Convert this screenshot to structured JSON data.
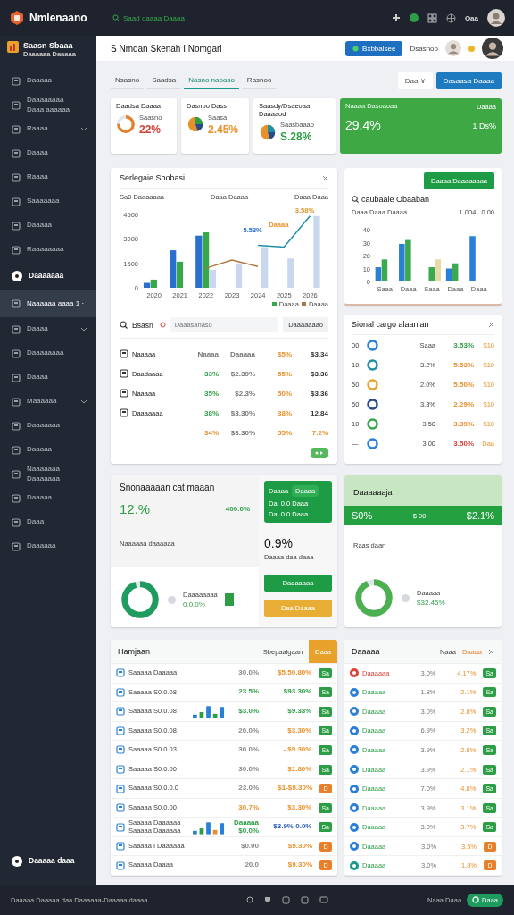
{
  "topbar": {
    "brand": "Nmlenaano",
    "search": "Saad daaaa Daaaa",
    "user_label": "Oaa"
  },
  "sidebar": {
    "workspace": "Saasn Sbaaa",
    "workspace_sub": "Daaaaaa Daaaaa",
    "items": [
      {
        "label": "Daaaaa",
        "kind": "link",
        "selected": false,
        "expandable": false
      },
      {
        "label": "Daaaaaaaa",
        "sublabel": "Daaa aaaaaa",
        "kind": "link",
        "selected": false,
        "expandable": false
      },
      {
        "label": "Raaaa",
        "kind": "link",
        "selected": false,
        "expandable": true
      },
      {
        "label": "Daaaa",
        "kind": "link",
        "selected": false,
        "expandable": false
      },
      {
        "label": "Raaaa",
        "kind": "link",
        "selected": false,
        "expandable": false
      },
      {
        "label": "Saaaaaaa",
        "kind": "link",
        "selected": false,
        "expandable": false
      },
      {
        "label": "Daaaaa",
        "kind": "link",
        "selected": false,
        "expandable": false
      },
      {
        "label": "Raaaaaaaa",
        "kind": "link",
        "selected": false,
        "expandable": false
      },
      {
        "label": "Daaaaaaa",
        "kind": "heading",
        "selected": false,
        "expandable": false
      },
      {
        "label": "Naaaaaa aaaa 1 ·",
        "kind": "link",
        "selected": true,
        "expandable": false
      },
      {
        "label": "Daaaa",
        "kind": "link",
        "selected": false,
        "expandable": true
      },
      {
        "label": "Daaaaaaaa",
        "kind": "link",
        "selected": false,
        "expandable": false
      },
      {
        "label": "Daaaa",
        "kind": "link",
        "selected": false,
        "expandable": false
      },
      {
        "label": "Maaaaaa",
        "kind": "link",
        "selected": false,
        "expandable": true
      },
      {
        "label": "Daaaaaaa",
        "kind": "link",
        "selected": false,
        "expandable": false
      },
      {
        "label": "Daaaaa",
        "kind": "link",
        "selected": false,
        "expandable": false
      },
      {
        "label": "Naaaaaaa",
        "sublabel": "Daaaaaaa",
        "kind": "link",
        "selected": false,
        "expandable": false
      },
      {
        "label": "Daaaaa",
        "kind": "link",
        "selected": false,
        "expandable": false
      },
      {
        "label": "Daaa",
        "kind": "link",
        "selected": false,
        "expandable": false
      },
      {
        "label": "Daaaaaa",
        "kind": "link",
        "selected": false,
        "expandable": false
      }
    ],
    "footer_item": {
      "label": "Daaaaa daaa",
      "kind": "heading"
    }
  },
  "header": {
    "title": "S Nmdan Skenah I Nomgari",
    "action_button": "Bxbbalsee",
    "user_name": "Dsasnoo"
  },
  "tabs": [
    {
      "label": "Nsasno",
      "selected": false
    },
    {
      "label": "Saadsa",
      "selected": false
    },
    {
      "label": "Nasno naoaso",
      "selected": true
    },
    {
      "label": "Rasnoo",
      "selected": false
    }
  ],
  "toolbar_buttons": [
    {
      "label": "Daa ∨",
      "kind": "secondary"
    },
    {
      "label": "Dasaasa Daaaa",
      "kind": "primary"
    }
  ],
  "kpis": [
    {
      "kind": "donut",
      "title": "Daadsa Daaaa",
      "label": "Saasno",
      "value": "22%",
      "color": "#d2453a"
    },
    {
      "kind": "icon",
      "title": "Dasnoo Dass",
      "label": "Saasa",
      "value": "2.45%",
      "color": "#e8912b"
    },
    {
      "kind": "icon",
      "title": "Saasdy/Dsaeoaa Daaaaod",
      "label": "Saasbaaao",
      "value": "S.28%",
      "color": "#2e9e46"
    },
    {
      "kind": "highlight",
      "title": "Naaaa Dasoaoaa",
      "side_label": "Daaaa",
      "value": "29.4%",
      "side_value": "1 Ds%"
    }
  ],
  "sales_card": {
    "title": "Serlegaie Sbobasi",
    "subtitle": "Sa0 Daaaaaaa",
    "filter_1": "Daaa Daaaa",
    "filter_2": "Daaa Daaa",
    "chart_data": {
      "type": "bar",
      "categories": [
        "2020",
        "2021",
        "2022",
        "2023",
        "2024",
        "2025",
        "2026"
      ],
      "ylim": [
        0,
        4500
      ],
      "yticks": [
        0,
        1500,
        3000,
        4500
      ],
      "series": [
        {
          "color": "#2a6fd0",
          "values": [
            300,
            2300,
            3200,
            null,
            null,
            null,
            null
          ]
        },
        {
          "color": "#36a84a",
          "values": [
            500,
            1600,
            3400,
            null,
            null,
            null,
            null
          ]
        },
        {
          "color": "#c9d8ef",
          "values": [
            null,
            null,
            1100,
            1500,
            2500,
            1800,
            4400
          ]
        },
        {
          "color": "#b07840",
          "type": "line",
          "values": [
            null,
            null,
            1200,
            1700,
            1300,
            null,
            null
          ]
        },
        {
          "color": "#1f8fa6",
          "type": "line",
          "values": [
            null,
            null,
            null,
            null,
            2600,
            2500,
            4400
          ]
        }
      ],
      "annotations": [
        "5.53%",
        "Daaaa",
        "3.58%"
      ]
    },
    "legend": [
      {
        "label": "Daaaa",
        "color": "#36a84a"
      },
      {
        "label": "Daaaa",
        "color": "#b07840"
      }
    ],
    "search_label": "Bsasn",
    "search_placeholder": "Daaasanaso",
    "dropdown": "Daaaaaaao",
    "rows": [
      {
        "name": "Naaaaa",
        "cells": [
          {
            "text": "Naaaa",
            "color": "#777777"
          },
          {
            "text": "Daaaaa",
            "color": "#777777"
          },
          {
            "text": "$5%",
            "color": "#e8912b"
          },
          {
            "text": "$3.34",
            "color": "#333333"
          }
        ]
      },
      {
        "name": "Daadaaaa",
        "cells": [
          {
            "text": "33%",
            "color": "#2e9e46"
          },
          {
            "text": "$2.39%",
            "color": "#777777"
          },
          {
            "text": "55%",
            "color": "#e8912b"
          },
          {
            "text": "$3.36",
            "color": "#333333"
          }
        ]
      },
      {
        "name": "Naaaaa",
        "cells": [
          {
            "text": "35%",
            "color": "#2e9e46"
          },
          {
            "text": "$2.3%",
            "color": "#777777"
          },
          {
            "text": "50%",
            "color": "#e8912b"
          },
          {
            "text": "$3.36",
            "color": "#333333"
          }
        ]
      },
      {
        "name": "Daaaaaaa",
        "cells": [
          {
            "text": "38%",
            "color": "#2e9e46"
          },
          {
            "text": "$3.30%",
            "color": "#777777"
          },
          {
            "text": "38%",
            "color": "#e8912b"
          },
          {
            "text": "12.84",
            "color": "#333333"
          }
        ]
      },
      {
        "name": "",
        "cells": [
          {
            "text": "34%",
            "color": "#e8912b"
          },
          {
            "text": "$3.30%",
            "color": "#777777"
          },
          {
            "text": "55%",
            "color": "#e8912b"
          },
          {
            "text": "7.2%",
            "color": "#e8912b"
          }
        ]
      }
    ]
  },
  "cost_card": {
    "button": "Daaaa Daaaaaaaa",
    "title": "caubaaie Obaaban",
    "subtitle": "Daaa Daaa Daaaa",
    "stat_1": "1.004",
    "stat_2": "0.00",
    "chart_data": {
      "type": "bar",
      "categories": [
        "Saaa",
        "Daaa",
        "Saaa",
        "Daaa",
        "Daaa"
      ],
      "ylim": [
        0,
        40
      ],
      "yticks": [
        0,
        10,
        20,
        30,
        40
      ],
      "series": [
        {
          "color": "#2a7fd8",
          "values": [
            11,
            29,
            null,
            10,
            35
          ]
        },
        {
          "color": "#3ba94f",
          "values": [
            17,
            32,
            11,
            14,
            null
          ]
        },
        {
          "color": "#e8d9a8",
          "values": [
            null,
            null,
            17,
            null,
            null
          ]
        }
      ]
    }
  },
  "signal_card": {
    "title": "Sional cargo alaanlan",
    "rows": [
      {
        "index": "00",
        "color": "#2a7fd8",
        "name": "Saaa",
        "value": {
          "text": "3.53%",
          "color": "#2e9e46"
        },
        "extra": "$10"
      },
      {
        "index": "10",
        "color": "#1f8fa6",
        "name": "3.2%",
        "value": {
          "text": "5.53%",
          "color": "#e8912b"
        },
        "extra": "$10"
      },
      {
        "index": "50",
        "color": "#e8a22b",
        "name": "2.0%",
        "value": {
          "text": "5.50%",
          "color": "#e8912b"
        },
        "extra": "$10"
      },
      {
        "index": "50",
        "color": "#274b8a",
        "name": "3.3%",
        "value": {
          "text": "2.29%",
          "color": "#e8912b"
        },
        "extra": "$10"
      },
      {
        "index": "10",
        "color": "#36a84a",
        "name": "3.50",
        "value": {
          "text": "3.39%",
          "color": "#e8912b"
        },
        "extra": "$10"
      },
      {
        "index": "—",
        "color": "#2a7fd8",
        "name": "3.00",
        "value": {
          "text": "3.50%",
          "color": "#d2453a"
        },
        "extra": "Daa"
      }
    ]
  },
  "summary_card": {
    "title": "Snonaaaaan cat maaan",
    "value": "12.%",
    "side_value": "400.0%",
    "label": "Naaaaaa daaaaaa",
    "legend_label": "Daaaaaaaa",
    "legend_value": "0.0.0%",
    "panel": {
      "title": "Daaaa",
      "field": "Daaaa",
      "lines": [
        "Da  0.0 Daaa",
        "Da  0.0 Daaa"
      ]
    },
    "big_value": "0.9%",
    "big_sub": "Daaaa daa daaa",
    "buttons": [
      {
        "label": "Daaaaaaa",
        "kind": "green"
      },
      {
        "label": "Daa Daaaa",
        "kind": "yellow"
      }
    ]
  },
  "growth_card": {
    "title": "Daaaaaaja",
    "band": [
      "S0%",
      "$ 00",
      "$2.1%"
    ],
    "label": "Raas daan",
    "legend_label": "Daaaaa",
    "legend_value": "$32.45%"
  },
  "orders_card": {
    "title": "Hamjaan",
    "link": "Sbepaalgaan",
    "button": "Daaa",
    "rows": [
      {
        "name": "Saaaaa Daaaaa",
        "kind": "plain",
        "pct": {
          "text": "30.0%",
          "color": "#888888"
        },
        "amount": {
          "text": "$5.50.80%",
          "color": "#e8912b"
        },
        "badge": {
          "text": "Sa",
          "color": "#2e9e46"
        }
      },
      {
        "name": "Saaaaa S0.0.08",
        "kind": "plain",
        "pct": {
          "text": "23.5%",
          "color": "#2e9e46"
        },
        "amount": {
          "text": "$93.30%",
          "color": "#2e9e46"
        },
        "badge": {
          "text": "Sa",
          "color": "#2e9e46"
        }
      },
      {
        "name": "Saaaaa S0.0.08",
        "kind": "chart",
        "pct": {
          "text": "$3.0%",
          "color": "#2e9e46"
        },
        "amount": {
          "text": "$9.33%",
          "color": "#2e9e46"
        },
        "badge": {
          "text": "Sa",
          "color": "#2e9e46"
        }
      },
      {
        "name": "Saaaaa S0.0.08",
        "kind": "plain",
        "pct": {
          "text": "20.0%",
          "color": "#888888"
        },
        "amount": {
          "text": "$3.30%",
          "color": "#e8912b"
        },
        "badge": {
          "text": "Sa",
          "color": "#2e9e46"
        }
      },
      {
        "name": "Saaaaa S0.0.03",
        "kind": "plain",
        "pct": {
          "text": "30.0%",
          "color": "#888888"
        },
        "amount": {
          "text": "- $9.30%",
          "color": "#e8912b"
        },
        "badge": {
          "text": "Sa",
          "color": "#2e9e46"
        }
      },
      {
        "name": "Saaaaa S0.0.00",
        "kind": "plain",
        "pct": {
          "text": "30.0%",
          "color": "#888888"
        },
        "amount": {
          "text": "$1.80%",
          "color": "#e8912b"
        },
        "badge": {
          "text": "Sa",
          "color": "#2e9e46"
        }
      },
      {
        "name": "Saaaaa S0.0.0.0",
        "kind": "plain",
        "pct": {
          "text": "23.0%",
          "color": "#888888"
        },
        "amount": {
          "text": "$1-$9.30%",
          "color": "#e8912b"
        },
        "badge": {
          "text": "D",
          "color": "#e8802b"
        }
      },
      {
        "name": "Saaaaa S0.0.00",
        "kind": "plain",
        "pct": {
          "text": "30.7%",
          "color": "#e8912b"
        },
        "amount": {
          "text": "$3.30%",
          "color": "#e8912b"
        },
        "badge": {
          "text": "Sa",
          "color": "#2e9e46"
        }
      },
      {
        "name": "Saaaaa Daaaaaa Saaaaa Daaaaaa",
        "kind": "chart2",
        "pct": {
          "text": "Daaaaa $0.0%",
          "color": "#2e9e46"
        },
        "amount": {
          "text": "$3.9% 0.0%",
          "color": "#2a5fb0"
        },
        "badge": {
          "text": "Sa",
          "color": "#2e9e46"
        }
      },
      {
        "name": "Saaaaa I Daaaaaa",
        "kind": "plain",
        "pct": {
          "text": "$0.00",
          "color": "#888888"
        },
        "amount": {
          "text": "$9.30%",
          "color": "#e8912b"
        },
        "badge": {
          "text": "D",
          "color": "#e8802b"
        }
      },
      {
        "name": "Saaaaa Daaaa",
        "kind": "plain",
        "pct": {
          "text": "20.0",
          "color": "#888888"
        },
        "amount": {
          "text": "$9.30%",
          "color": "#e8912b"
        },
        "badge": {
          "text": "D",
          "color": "#e8802b"
        }
      }
    ]
  },
  "regions_card": {
    "title": "Daaaaa",
    "col_1": "Naaa",
    "col_2": "Daaaa",
    "rows": [
      {
        "color": "#d8453a",
        "name": "Daaaaaa",
        "value": "3.0%",
        "pct": "4.17%",
        "badge": {
          "text": "Sa",
          "color": "#2e9e46"
        }
      },
      {
        "color": "#2a7fd8",
        "name": "Daaaaa",
        "value": "1.8%",
        "pct": "2.1%",
        "badge": {
          "text": "Sa",
          "color": "#2e9e46"
        }
      },
      {
        "color": "#2a7fd8",
        "name": "Daaaaa",
        "value": "3.0%",
        "pct": "2.8%",
        "badge": {
          "text": "Sa",
          "color": "#2e9e46"
        }
      },
      {
        "color": "#2a7fd8",
        "name": "Daaaaa",
        "value": "6.9%",
        "pct": "3.2%",
        "badge": {
          "text": "Sa",
          "color": "#2e9e46"
        }
      },
      {
        "color": "#2a7fd8",
        "name": "Daaaaa",
        "value": "3.9%",
        "pct": "2.8%",
        "badge": {
          "text": "Sa",
          "color": "#2e9e46"
        }
      },
      {
        "color": "#2a7fd8",
        "name": "Daaaaa",
        "value": "3.9%",
        "pct": "2.1%",
        "badge": {
          "text": "Sa",
          "color": "#2e9e46"
        }
      },
      {
        "color": "#2a7fd8",
        "name": "Daaaaa",
        "value": "7.0%",
        "pct": "4.8%",
        "badge": {
          "text": "Sa",
          "color": "#2e9e46"
        }
      },
      {
        "color": "#2a7fd8",
        "name": "Daaaaa",
        "value": "3.9%",
        "pct": "3.1%",
        "badge": {
          "text": "Sa",
          "color": "#2e9e46"
        }
      },
      {
        "color": "#2a7fd8",
        "name": "Daaaaa",
        "value": "3.0%",
        "pct": "3.7%",
        "badge": {
          "text": "Sa",
          "color": "#2e9e46"
        }
      },
      {
        "color": "#2a7fd8",
        "name": "Daaaaa",
        "value": "3.0%",
        "pct": "3.5%",
        "badge": {
          "text": "D",
          "color": "#e8802b"
        }
      },
      {
        "color": "#1a9a8a",
        "name": "Daaaaa",
        "value": "3.0%",
        "pct": "1.8%",
        "badge": {
          "text": "D",
          "color": "#e8802b"
        }
      }
    ]
  },
  "footer": {
    "text": "Daaaaa Daaaaa daa Daaaaaa-Daaaaa daaaa",
    "user": "Naaa Daaa",
    "status": "Daaa"
  }
}
